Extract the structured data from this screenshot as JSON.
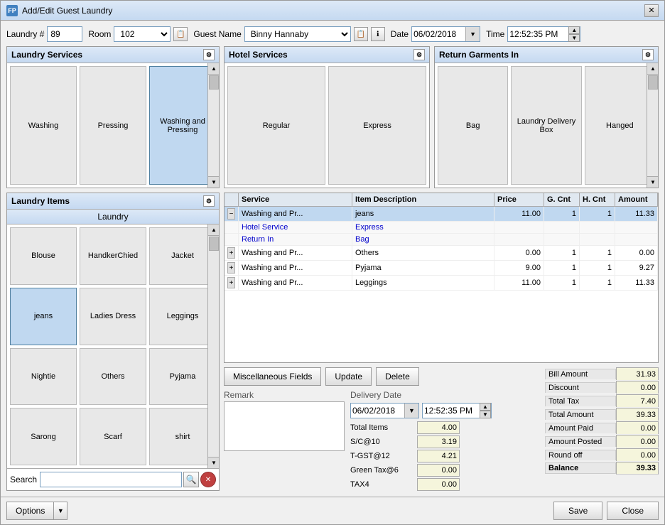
{
  "window": {
    "title": "Add/Edit Guest Laundry",
    "icon": "FP"
  },
  "header": {
    "laundry_label": "Laundry #",
    "laundry_value": "89",
    "room_label": "Room",
    "room_value": "102",
    "guest_name_label": "Guest Name",
    "guest_name_value": "Binny Hannaby",
    "date_label": "Date",
    "date_value": "06/02/2018",
    "time_label": "Time",
    "time_value": "12:52:35 PM"
  },
  "laundry_services": {
    "title": "Laundry Services",
    "tiles": [
      {
        "id": "washing",
        "label": "Washing",
        "selected": false
      },
      {
        "id": "pressing",
        "label": "Pressing",
        "selected": false
      },
      {
        "id": "washing-pressing",
        "label": "Washing and Pressing",
        "selected": true
      }
    ]
  },
  "hotel_services": {
    "title": "Hotel Services",
    "tiles": [
      {
        "id": "regular",
        "label": "Regular",
        "selected": false
      },
      {
        "id": "express",
        "label": "Express",
        "selected": false
      }
    ]
  },
  "return_garments": {
    "title": "Return Garments In",
    "tiles": [
      {
        "id": "bag",
        "label": "Bag",
        "selected": false
      },
      {
        "id": "laundry-delivery-box",
        "label": "Laundry Delivery Box",
        "selected": false
      },
      {
        "id": "hanged",
        "label": "Hanged",
        "selected": false
      }
    ]
  },
  "laundry_items": {
    "title": "Laundry Items",
    "sub_label": "Laundry",
    "items": [
      {
        "id": "blouse",
        "label": "Blouse",
        "selected": false
      },
      {
        "id": "handkerchief",
        "label": "HandkerChied",
        "selected": false
      },
      {
        "id": "jacket",
        "label": "Jacket",
        "selected": false
      },
      {
        "id": "jeans",
        "label": "jeans",
        "selected": true
      },
      {
        "id": "ladies-dress",
        "label": "Ladies Dress",
        "selected": false
      },
      {
        "id": "leggings",
        "label": "Leggings",
        "selected": false
      },
      {
        "id": "nightie",
        "label": "Nightie",
        "selected": false
      },
      {
        "id": "others",
        "label": "Others",
        "selected": false
      },
      {
        "id": "pyjama",
        "label": "Pyjama",
        "selected": false
      },
      {
        "id": "sarong",
        "label": "Sarong",
        "selected": false
      },
      {
        "id": "scarf",
        "label": "Scarf",
        "selected": false
      },
      {
        "id": "shirt",
        "label": "shirt",
        "selected": false
      }
    ]
  },
  "table": {
    "columns": [
      "",
      "Service",
      "Item Description",
      "Price",
      "G. Cnt",
      "H. Cnt",
      "Amount"
    ],
    "rows": [
      {
        "expand": "-",
        "service": "Washing and Pr...",
        "description": "jeans",
        "price": "11.00",
        "g_cnt": "1",
        "h_cnt": "1",
        "amount": "11.33",
        "selected": true,
        "children": [
          {
            "label": "Hotel Service",
            "value": "Express",
            "type": "hotel"
          },
          {
            "label": "Return In",
            "value": "Bag",
            "type": "return"
          }
        ]
      },
      {
        "expand": "+",
        "service": "Washing and Pr...",
        "description": "Others",
        "price": "0.00",
        "g_cnt": "1",
        "h_cnt": "1",
        "amount": "0.00",
        "selected": false
      },
      {
        "expand": "+",
        "service": "Washing and Pr...",
        "description": "Pyjama",
        "price": "9.00",
        "g_cnt": "1",
        "h_cnt": "1",
        "amount": "9.27",
        "selected": false
      },
      {
        "expand": "+",
        "service": "Washing and Pr...",
        "description": "Leggings",
        "price": "11.00",
        "g_cnt": "1",
        "h_cnt": "1",
        "amount": "11.33",
        "selected": false
      }
    ]
  },
  "actions": {
    "misc_fields": "Miscellaneous Fields",
    "update": "Update",
    "delete": "Delete"
  },
  "remark": {
    "label": "Remark",
    "value": ""
  },
  "totals": {
    "total_items_label": "Total Items",
    "total_items_value": "4.00",
    "sc_label": "S/C@10",
    "sc_value": "3.19",
    "t_gst_label": "T-GST@12",
    "t_gst_value": "4.21",
    "green_tax_label": "Green Tax@6",
    "green_tax_value": "0.00",
    "tax4_label": "TAX4",
    "tax4_value": "0.00"
  },
  "summary": {
    "bill_amount_label": "Bill Amount",
    "bill_amount_value": "31.93",
    "discount_label": "Discount",
    "discount_value": "0.00",
    "total_tax_label": "Total Tax",
    "total_tax_value": "7.40",
    "total_amount_label": "Total Amount",
    "total_amount_value": "39.33",
    "amount_paid_label": "Amount Paid",
    "amount_paid_value": "0.00",
    "amount_posted_label": "Amount Posted",
    "amount_posted_value": "0.00",
    "round_off_label": "Round off",
    "round_off_value": "0.00",
    "balance_label": "Balance",
    "balance_value": "39.33"
  },
  "delivery": {
    "label": "Delivery Date",
    "date_value": "06/02/2018",
    "time_value": "12:52:35 PM"
  },
  "search": {
    "label": "Search",
    "placeholder": ""
  },
  "footer": {
    "options_label": "Options",
    "save_label": "Save",
    "close_label": "Close"
  }
}
